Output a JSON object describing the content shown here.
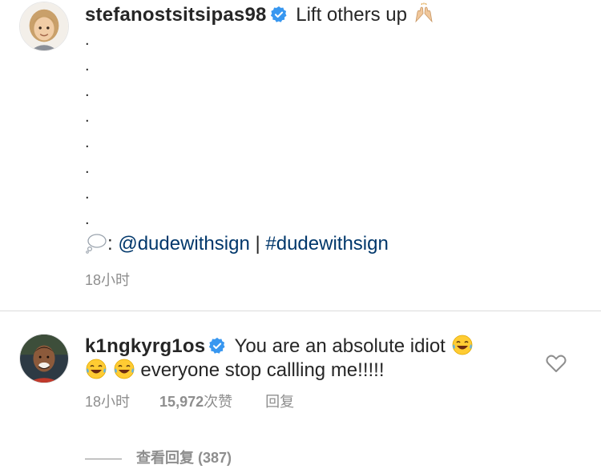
{
  "post": {
    "author": "stefanostsitsipas98",
    "caption_text": "Lift others up",
    "caption_emoji": "raising-hands-emoji",
    "dots": [
      ".",
      ".",
      ".",
      ".",
      ".",
      ".",
      ".",
      "."
    ],
    "credit_prefix": ": ",
    "credit_mention": "@dudewithsign",
    "credit_separator": " | ",
    "credit_hashtag": "#dudewithsign",
    "credit_emoji": "thought-balloon-emoji",
    "timestamp": "18小时"
  },
  "comment": {
    "author": "k1ngkyrg1os",
    "text_line1": "You are an absolute idiot",
    "text_line2": "everyone stop callling me!!!!!",
    "emoji": "face-with-tears-of-joy-emoji",
    "timestamp": "18小时",
    "likes": "15,972",
    "likes_label": "次赞",
    "reply_label": "回复",
    "view_replies_label": "查看回复 (387)"
  },
  "colors": {
    "text": "#262626",
    "secondary": "#8e8e8e",
    "link": "#00376b",
    "verified": "#3897f0",
    "divider": "#dbdbdb"
  }
}
